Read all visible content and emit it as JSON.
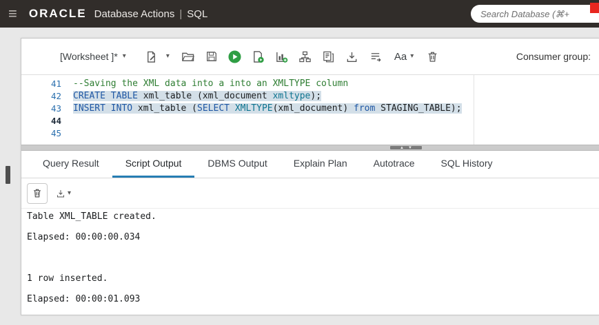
{
  "icons": {
    "menu": "≡",
    "chevron_down": "▾",
    "grip_up": "▲",
    "grip_down": "▼"
  },
  "topbar": {
    "brand": "ORACLE",
    "product": "Database Actions",
    "divider": "|",
    "section": "SQL",
    "search": {
      "placeholder": "Search Database (⌘+"
    }
  },
  "toolbar": {
    "worksheet_label": "[Worksheet ]*",
    "font_size_label": "Aa",
    "consumer_group_label": "Consumer group:",
    "icons": [
      "new-worksheet",
      "open-file",
      "save",
      "run-statement",
      "run-script",
      "explain-plan",
      "autotrace",
      "serveroutput",
      "download",
      "format",
      "font-size",
      "clear"
    ]
  },
  "editor": {
    "lines": [
      {
        "number": 41,
        "selected": false,
        "current": false,
        "tokens": [
          {
            "c": "comment",
            "t": "--Saving the XML data into a into an XMLTYPE column"
          }
        ]
      },
      {
        "number": 42,
        "selected": true,
        "current": false,
        "tokens": [
          {
            "c": "keyword",
            "t": "CREATE TABLE"
          },
          {
            "c": "plain",
            "t": " xml_table (xml_document "
          },
          {
            "c": "type",
            "t": "xmltype"
          },
          {
            "c": "plain",
            "t": ");"
          }
        ]
      },
      {
        "number": 43,
        "selected": true,
        "current": false,
        "tokens": [
          {
            "c": "keyword",
            "t": "INSERT INTO"
          },
          {
            "c": "plain",
            "t": " xml_table ("
          },
          {
            "c": "keyword",
            "t": "SELECT"
          },
          {
            "c": "plain",
            "t": " "
          },
          {
            "c": "type",
            "t": "XMLTYPE"
          },
          {
            "c": "plain",
            "t": "(xml_document) "
          },
          {
            "c": "keyword",
            "t": "from"
          },
          {
            "c": "plain",
            "t": " STAGING_TABLE);"
          }
        ]
      },
      {
        "number": 44,
        "selected": false,
        "current": true,
        "tokens": []
      },
      {
        "number": 45,
        "selected": false,
        "current": false,
        "tokens": []
      }
    ]
  },
  "tabs": [
    {
      "label": "Query Result",
      "active": false
    },
    {
      "label": "Script Output",
      "active": true
    },
    {
      "label": "DBMS Output",
      "active": false
    },
    {
      "label": "Explain Plan",
      "active": false
    },
    {
      "label": "Autotrace",
      "active": false
    },
    {
      "label": "SQL History",
      "active": false
    }
  ],
  "output_toolbar": {
    "icons": [
      "clear-output",
      "download-output"
    ]
  },
  "output": {
    "lines": [
      "Table XML_TABLE created.",
      "",
      "Elapsed: 00:00:00.034",
      "",
      "",
      "",
      "1 row inserted.",
      "",
      "Elapsed: 00:00:01.093"
    ]
  },
  "colors": {
    "accent": "#267db3",
    "run_green": "#2f9e44",
    "topbar_bg": "#312d2a",
    "selection": "#d3dfe8",
    "badge_red": "#e8261f"
  }
}
